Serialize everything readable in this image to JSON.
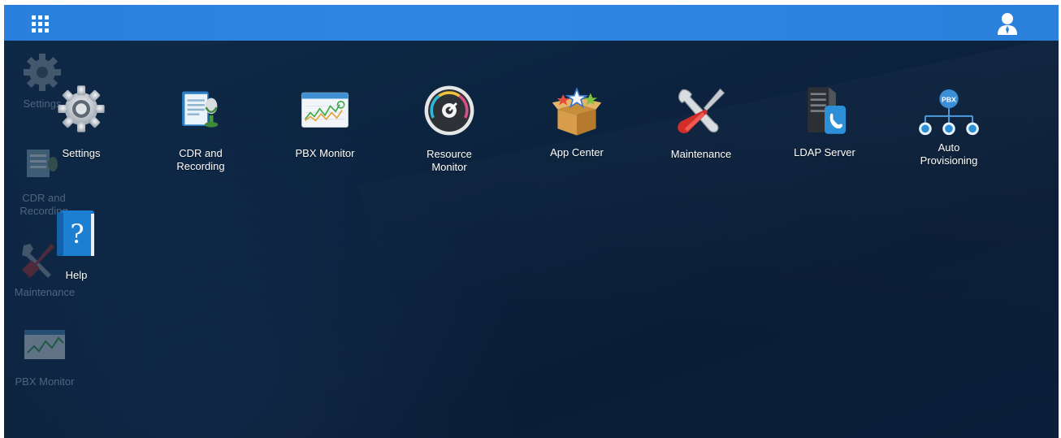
{
  "topbar": {
    "menu_icon": "app-grid-icon",
    "user_icon": "user-account-icon",
    "color": "#2b80dc"
  },
  "apps": [
    {
      "label": "Settings",
      "icon": "gear-icon"
    },
    {
      "label": "CDR and Recording",
      "icon": "cdr-recording-icon"
    },
    {
      "label": "PBX Monitor",
      "icon": "pbx-monitor-icon"
    },
    {
      "label": "Resource Monitor",
      "icon": "gauge-icon"
    },
    {
      "label": "App Center",
      "icon": "app-box-icon"
    },
    {
      "label": "Maintenance",
      "icon": "wrench-screwdriver-icon"
    },
    {
      "label": "LDAP Server",
      "icon": "ldap-server-icon"
    },
    {
      "label": "Auto Provisioning",
      "icon": "provisioning-tree-icon"
    }
  ],
  "desktop_shortcuts": [
    {
      "label": "Settings",
      "icon": "gear-icon"
    },
    {
      "label": "CDR and Recording",
      "icon": "cdr-recording-icon"
    },
    {
      "label": "Maintenance",
      "icon": "wrench-screwdriver-icon"
    },
    {
      "label": "PBX Monitor",
      "icon": "pbx-monitor-icon"
    }
  ],
  "help": {
    "label": "Help",
    "icon": "help-book-icon"
  },
  "auto_provisioning_badge": "PBX"
}
